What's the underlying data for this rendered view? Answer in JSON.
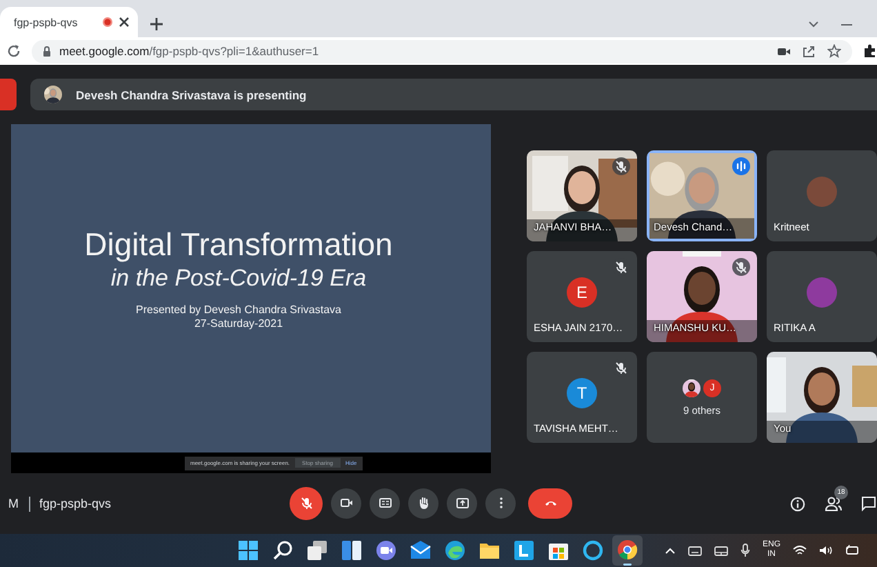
{
  "browser": {
    "tab": {
      "title": "fgp-pspb-qvs"
    },
    "address": {
      "host": "meet.google.com",
      "path": "/fgp-pspb-qvs?pli=1&authuser=1"
    }
  },
  "banner": {
    "text": "Devesh Chandra Srivastava is presenting"
  },
  "slide": {
    "title": "Digital Transformation",
    "subtitle": "in the Post-Covid-19 Era",
    "byline": "Presented by Devesh Chandra Srivastava",
    "date": "27-Saturday-2021"
  },
  "share_notice": {
    "text": "meet.google.com is sharing your screen.",
    "stop_button": "Stop sharing",
    "hide_link": "Hide"
  },
  "tiles": [
    {
      "kind": "video",
      "name": "JAHANVI BHA…",
      "muted": true,
      "speaking": false
    },
    {
      "kind": "video",
      "name": "Devesh Chand…",
      "muted": false,
      "speaking": true
    },
    {
      "kind": "avatar",
      "name": "Kritneet",
      "color": "#7b4a3a",
      "muted": false,
      "speaking": false
    },
    {
      "kind": "avatar",
      "initial": "E",
      "name": "ESHA JAIN 2170…",
      "color": "#d93025",
      "muted": true,
      "speaking": false
    },
    {
      "kind": "video",
      "name": "HIMANSHU KU…",
      "muted": true,
      "speaking": false
    },
    {
      "kind": "avatar",
      "name": "RITIKA A",
      "color": "#8e3a9e",
      "muted": false,
      "speaking": false
    },
    {
      "kind": "avatar",
      "initial": "T",
      "name": "TAVISHA MEHT…",
      "color": "#1a8ad8",
      "muted": true,
      "speaking": false
    },
    {
      "kind": "others",
      "label": "9 others",
      "muted": false,
      "speaking": false,
      "avatars": [
        {
          "kind": "picture"
        },
        {
          "kind": "initial",
          "initial": "J",
          "color": "#d93025"
        }
      ]
    },
    {
      "kind": "video",
      "name": "You",
      "muted": false,
      "speaking": false
    }
  ],
  "meeting_bar": {
    "clock": "M",
    "code": "fgp-pspb-qvs",
    "controls": [
      {
        "kind": "mic",
        "muted": true
      },
      {
        "kind": "camera"
      },
      {
        "kind": "captions"
      },
      {
        "kind": "hand"
      },
      {
        "kind": "present"
      },
      {
        "kind": "more"
      },
      {
        "kind": "leave"
      }
    ],
    "participant_count": "18"
  },
  "taskbar": {
    "apps": [
      {
        "kind": "start",
        "active": false
      },
      {
        "kind": "search",
        "active": false
      },
      {
        "kind": "task-view",
        "active": false
      },
      {
        "kind": "widgets",
        "active": false
      },
      {
        "kind": "chat",
        "active": false
      },
      {
        "kind": "mail",
        "active": false
      },
      {
        "kind": "edge",
        "active": false
      },
      {
        "kind": "files",
        "active": false
      },
      {
        "kind": "l-app",
        "active": false
      },
      {
        "kind": "store",
        "active": false
      },
      {
        "kind": "alexa",
        "active": false
      },
      {
        "kind": "chrome",
        "active": true
      }
    ],
    "language": "ENG",
    "region": "IN"
  }
}
